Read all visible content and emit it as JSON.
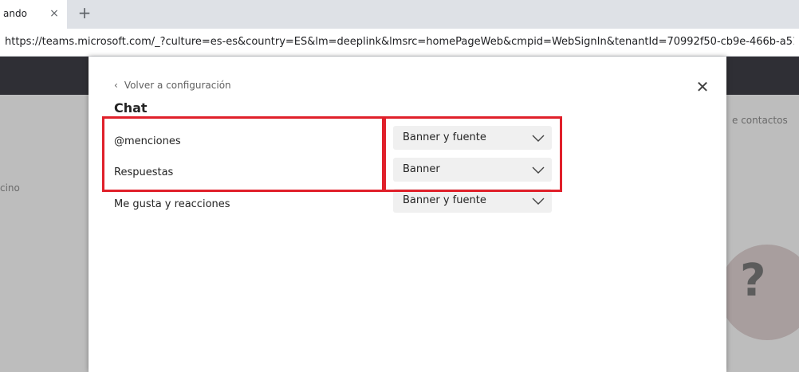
{
  "browser": {
    "tab_title": "ando",
    "tab_close_icon": "×",
    "new_tab_icon": "+",
    "url": "https://teams.microsoft.com/_?culture=es-es&country=ES&lm=deeplink&lmsrc=homePageWeb&cmpid=WebSignIn&tenantId=70992f50-cb9e-466b-a519-..."
  },
  "background": {
    "left_text": "cino",
    "right_text": "e contactos",
    "help_icon": "?"
  },
  "modal": {
    "back_chevron": "‹",
    "back_label": "Volver a configuración",
    "close_icon": "✕",
    "title": "Chat",
    "rows": [
      {
        "label": "@menciones",
        "value": "Banner y fuente"
      },
      {
        "label": "Respuestas",
        "value": "Banner"
      },
      {
        "label": "Me gusta y reacciones",
        "value": "Banner y fuente"
      }
    ]
  },
  "colors": {
    "annotation": "#e0202a",
    "select_bg": "#f0f0f0",
    "header_dark": "#2f2f35"
  }
}
